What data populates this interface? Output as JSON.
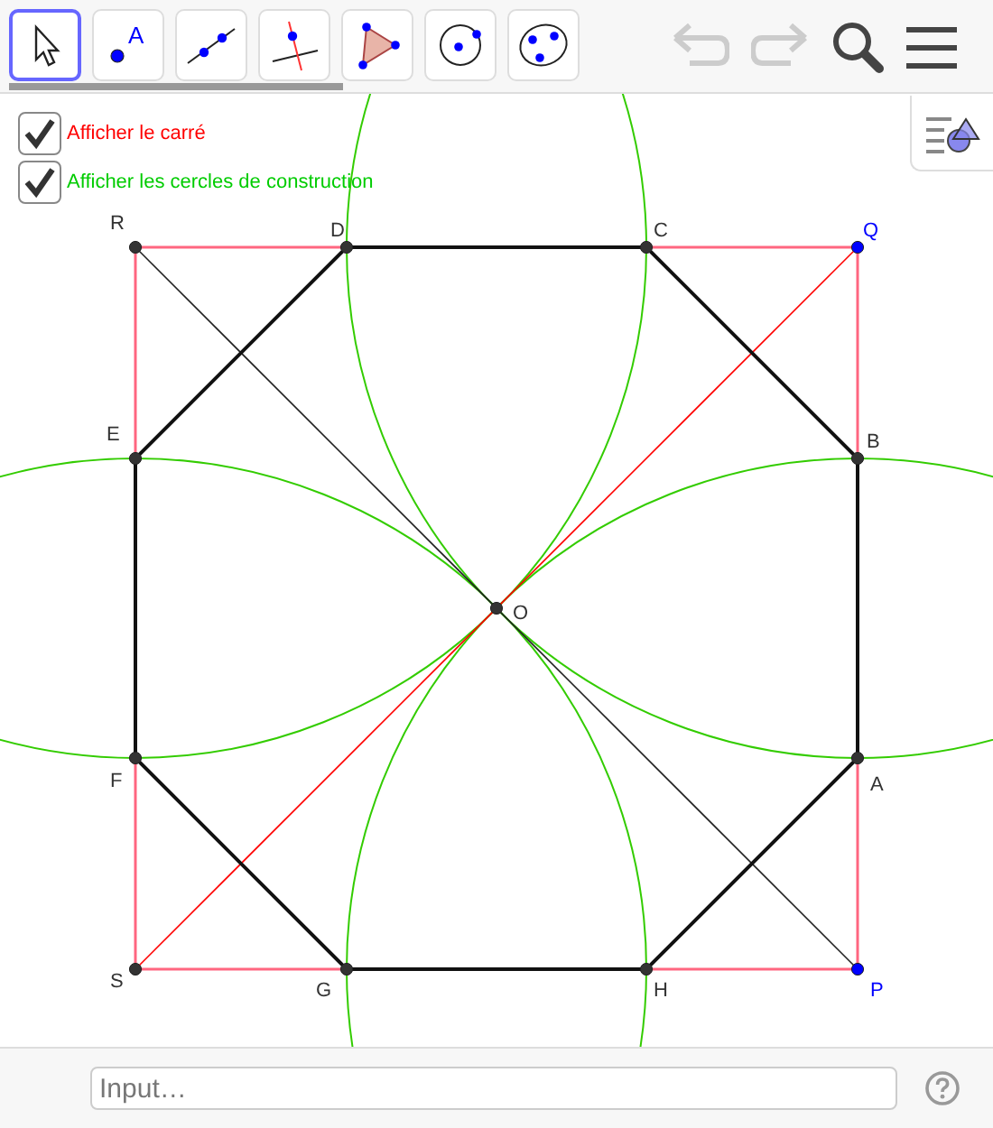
{
  "toolbar": {
    "tools": [
      {
        "kind": "move",
        "selected": true
      },
      {
        "kind": "point",
        "label": "A",
        "selected": false
      },
      {
        "kind": "line",
        "selected": false
      },
      {
        "kind": "perpendicular",
        "selected": false
      },
      {
        "kind": "polygon",
        "selected": false
      },
      {
        "kind": "circle",
        "selected": false
      },
      {
        "kind": "conic",
        "selected": false
      }
    ],
    "undo": {
      "disabled": true
    },
    "redo": {
      "disabled": true
    }
  },
  "checkboxes": [
    {
      "label": "Afficher le carré",
      "checked": true,
      "color": "#ff0000"
    },
    {
      "label": "Afficher les cercles de construction",
      "checked": true,
      "color": "#00cc00"
    }
  ],
  "points": [
    {
      "label": "R",
      "color": "#333333"
    },
    {
      "label": "D",
      "color": "#333333"
    },
    {
      "label": "C",
      "color": "#333333"
    },
    {
      "label": "Q",
      "color": "#0000ff"
    },
    {
      "label": "E",
      "color": "#333333"
    },
    {
      "label": "B",
      "color": "#333333"
    },
    {
      "label": "O",
      "color": "#333333"
    },
    {
      "label": "F",
      "color": "#333333"
    },
    {
      "label": "A",
      "color": "#333333"
    },
    {
      "label": "S",
      "color": "#333333"
    },
    {
      "label": "G",
      "color": "#333333"
    },
    {
      "label": "H",
      "color": "#333333"
    },
    {
      "label": "P",
      "color": "#0000ff"
    }
  ],
  "input_bar": {
    "placeholder": "Input…"
  }
}
